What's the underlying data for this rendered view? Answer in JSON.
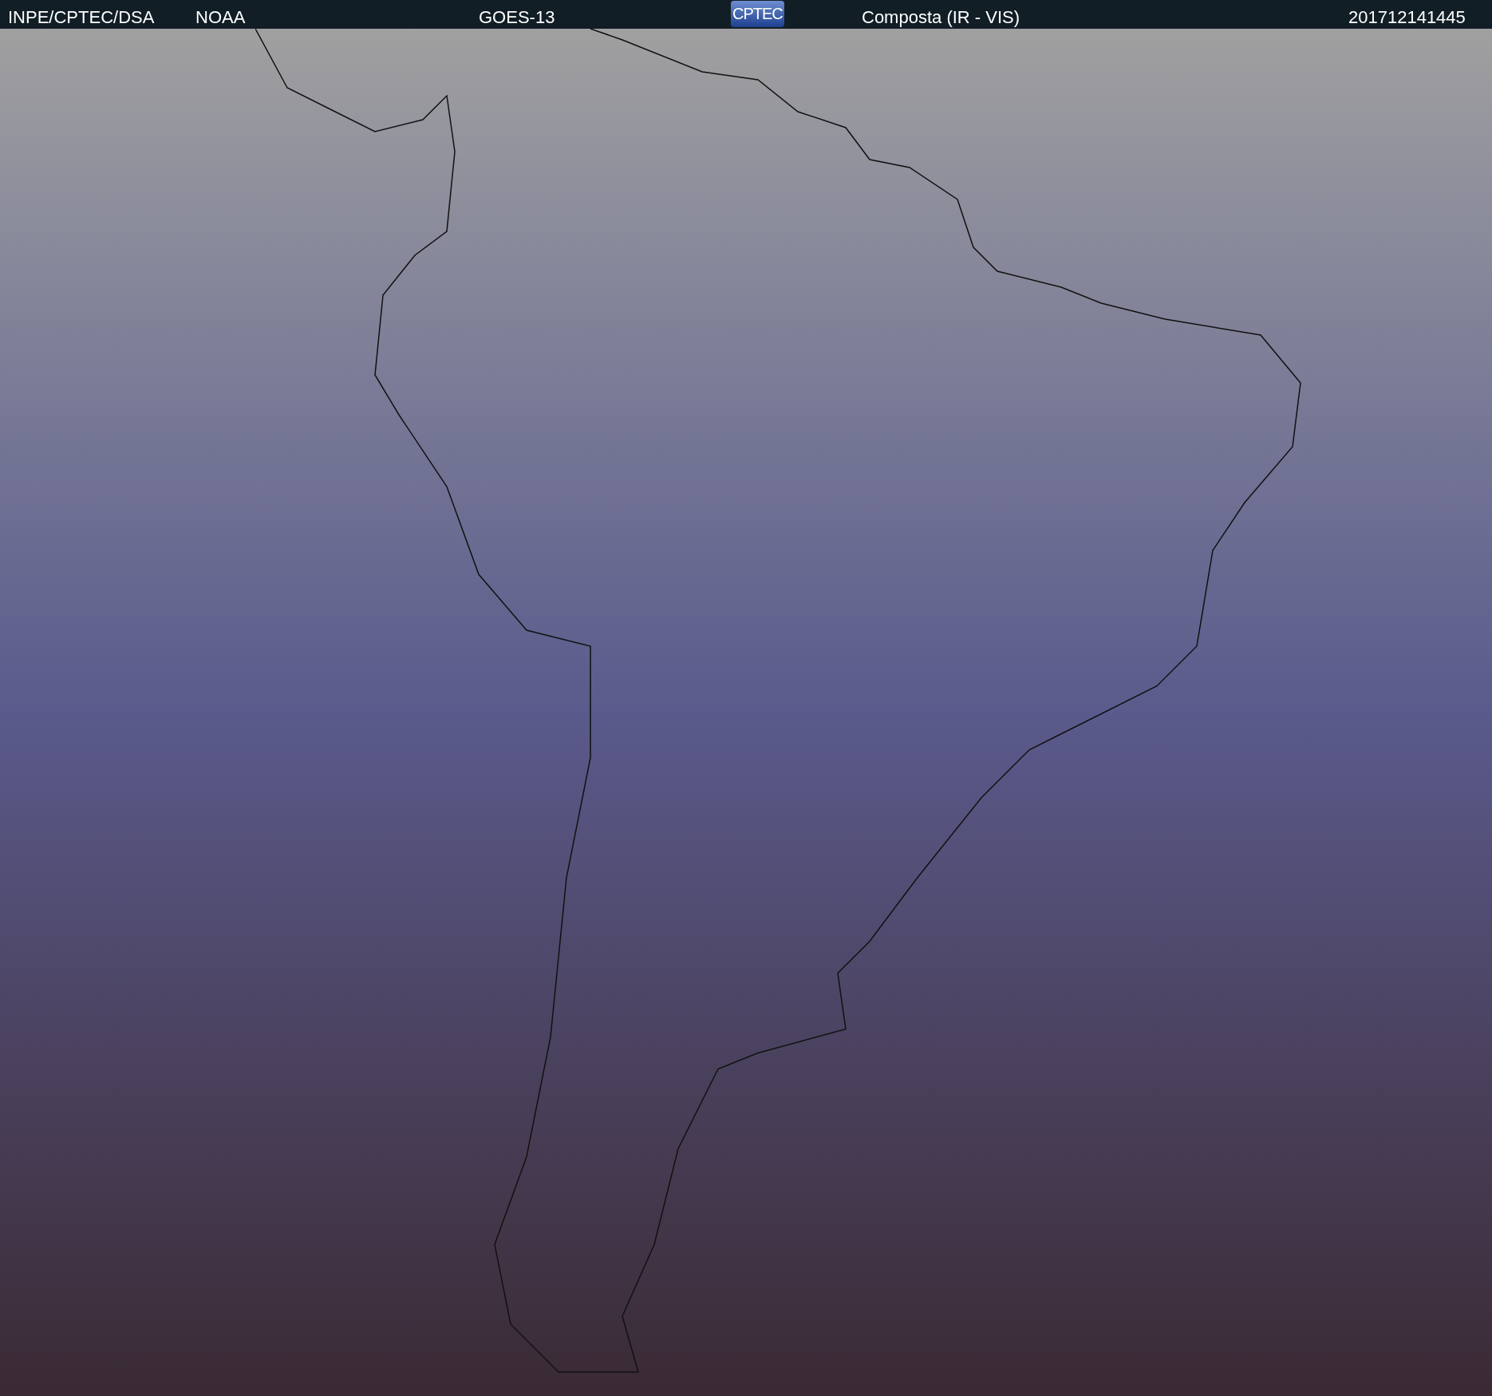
{
  "header": {
    "agency": "INPE/CPTEC/DSA",
    "source": "NOAA",
    "satellite": "GOES-13",
    "logo": "CPTEC",
    "product": "Composta (IR - VIS)",
    "timestamp": "201712141445"
  }
}
